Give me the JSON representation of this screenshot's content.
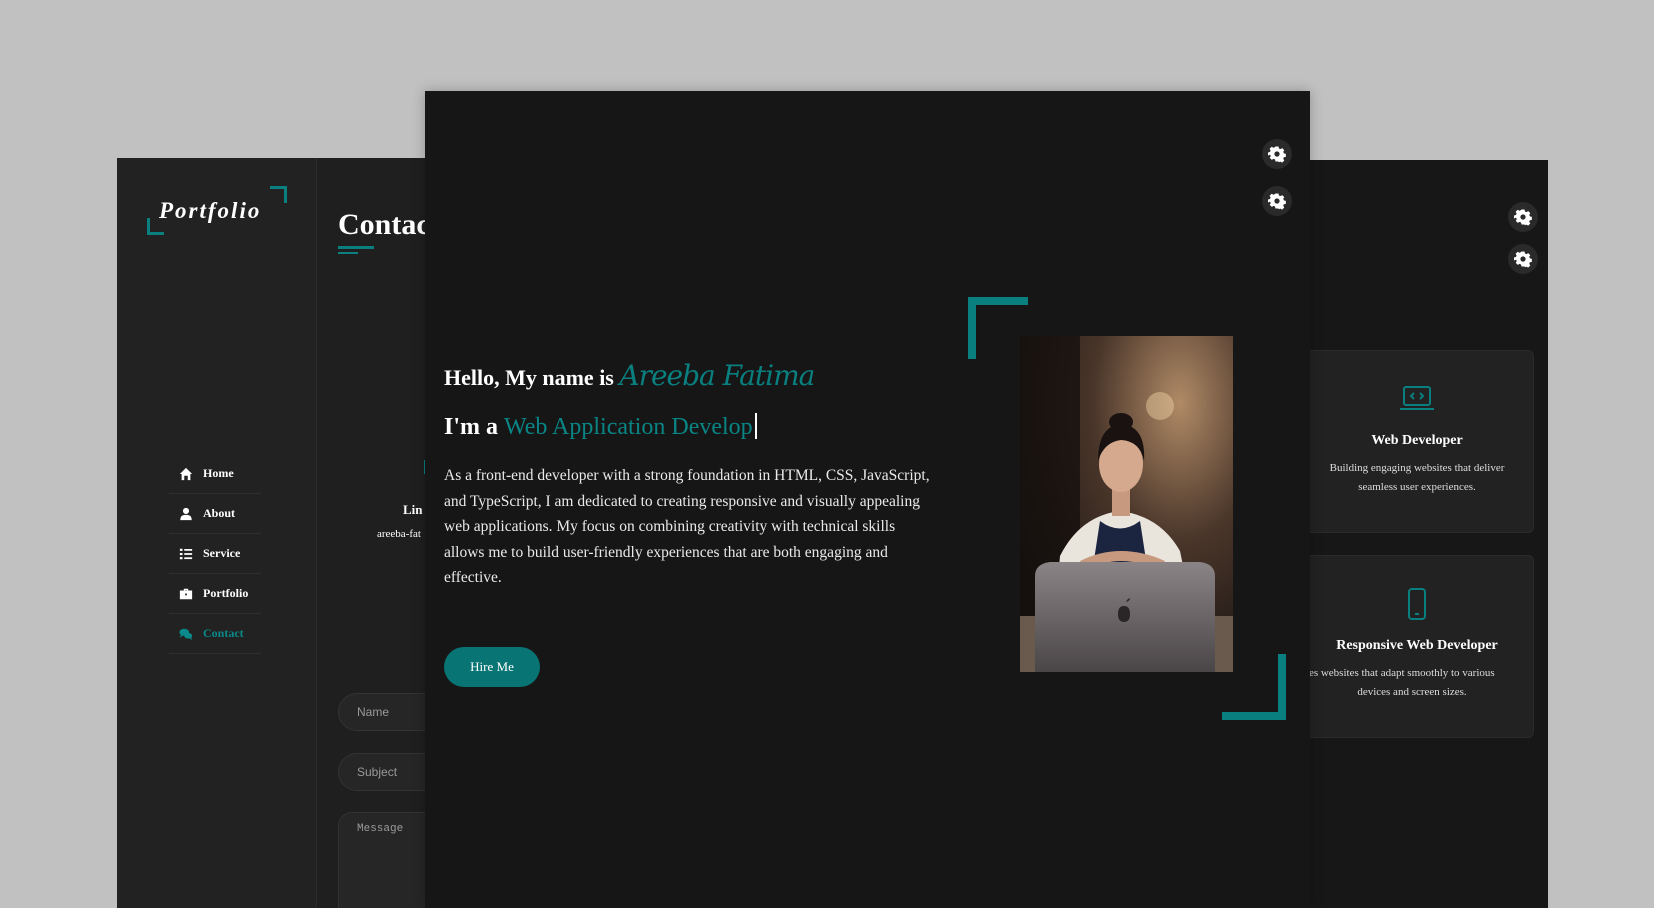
{
  "left_window": {
    "logo": "Portfolio",
    "nav": [
      {
        "label": "Home",
        "icon": "home-icon"
      },
      {
        "label": "About",
        "icon": "user-icon"
      },
      {
        "label": "Service",
        "icon": "list-icon"
      },
      {
        "label": "Portfolio",
        "icon": "briefcase-icon"
      },
      {
        "label": "Contact",
        "icon": "chat-icon",
        "active": true
      }
    ],
    "page_title": "Contac",
    "contact_label": "Lin",
    "contact_value": "areeba-fat",
    "form": {
      "name_placeholder": "Name",
      "subject_placeholder": "Subject",
      "message_placeholder": "Message"
    }
  },
  "front_window": {
    "greeting_prefix": "Hello, My name is ",
    "name": "Areeba Fatima",
    "role_prefix": "I'm a ",
    "role": "Web Application Develop",
    "description": "As a front-end developer with a strong foundation in HTML, CSS, JavaScript, and TypeScript, I am dedicated to creating responsive and visually appealing web applications. My focus on combining creativity with technical skills allows me to build user-friendly experiences that are both engaging and effective.",
    "hire_button": "Hire Me",
    "settings_icons": [
      "gear-icon",
      "theme-gear-icon"
    ]
  },
  "right_window": {
    "services": [
      {
        "icon": "laptop-code-icon",
        "title": "Web Developer",
        "desc_line1": "Building engaging websites that deliver",
        "desc_line2": "seamless user experiences."
      },
      {
        "icon": "mobile-icon",
        "title": "Responsive Web Developer",
        "desc_line1": "ates websites that adapt smoothly to various",
        "desc_line2": "devices and screen sizes."
      }
    ]
  },
  "colors": {
    "accent": "#0a7f7f",
    "background_outer": "#c1c1c1",
    "panel_dark": "#161616",
    "sidebar": "#222222"
  }
}
